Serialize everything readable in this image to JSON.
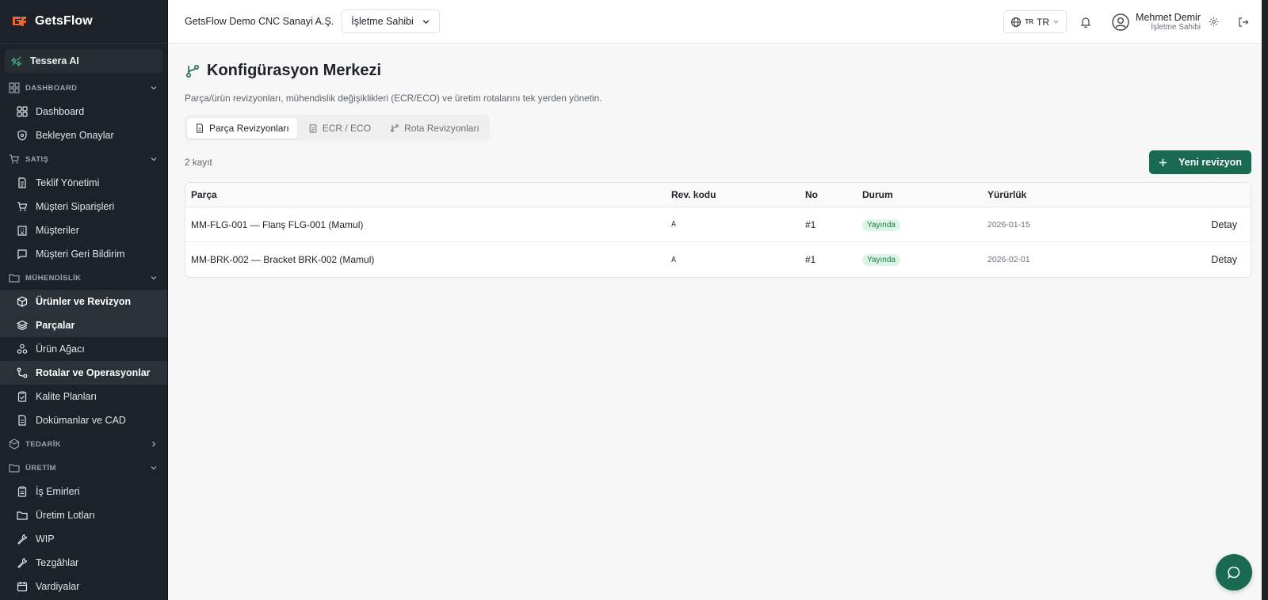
{
  "brand": {
    "name": "GetsFlow",
    "accent": "#f0652f"
  },
  "ai": {
    "label": "Tessera AI"
  },
  "sidebar": {
    "sections": [
      {
        "label": "DASHBOARD",
        "items": [
          {
            "label": "Dashboard",
            "icon": "grid-icon"
          },
          {
            "label": "Bekleyen Onaylar",
            "icon": "shield-icon"
          }
        ]
      },
      {
        "label": "SATIŞ",
        "items": [
          {
            "label": "Teklif Yönetimi",
            "icon": "document-icon"
          },
          {
            "label": "Müşteri Siparişleri",
            "icon": "cart-icon"
          },
          {
            "label": "Müşteriler",
            "icon": "building-icon"
          },
          {
            "label": "Müşteri Geri Bildirim",
            "icon": "message-icon"
          }
        ]
      },
      {
        "label": "MÜHENDİSLİK",
        "items": [
          {
            "label": "Ürünler ve Revizyon",
            "icon": "package-icon"
          },
          {
            "label": "Parçalar",
            "icon": "layers-icon"
          },
          {
            "label": "Ürün Ağacı",
            "icon": "tree-icon"
          },
          {
            "label": "Rotalar ve Operasyonlar",
            "icon": "route-icon"
          },
          {
            "label": "Kalite Planları",
            "icon": "clipboard-check-icon"
          },
          {
            "label": "Dokümanlar ve CAD",
            "icon": "file-icon"
          }
        ]
      },
      {
        "label": "TEDARİK",
        "items": []
      },
      {
        "label": "ÜRETİM",
        "items": [
          {
            "label": "İş Emirleri",
            "icon": "clipboard-icon"
          },
          {
            "label": "Üretim Lotları",
            "icon": "folder-icon"
          },
          {
            "label": "WIP",
            "icon": "wrench-icon"
          },
          {
            "label": "Tezgâhlar",
            "icon": "wrench-icon"
          },
          {
            "label": "Vardiyalar",
            "icon": "calendar-icon"
          }
        ]
      }
    ]
  },
  "header": {
    "company": "GetsFlow Demo CNC Sanayi A.Ş.",
    "role": "İşletme Sahibi",
    "lang_small": "TR",
    "lang": "TR",
    "user_name": "Mehmet Demir",
    "user_role": "İşletme Sahibi"
  },
  "page": {
    "title": "Konfigürasyon Merkezi",
    "subtitle": "Parça/ürün revizyonları, mühendislik değişiklikleri (ECR/ECO) ve üretim rotalarını tek yerden yönetin.",
    "tabs": [
      "Parça Revizyonları",
      "ECR / ECO",
      "Rota Revizyonları"
    ],
    "count": "2 kayıt",
    "new_button": "Yeni revizyon"
  },
  "table": {
    "headers": [
      "Parça",
      "Rev. kodu",
      "No",
      "Durum",
      "Yürürlük"
    ],
    "rows": [
      {
        "part": "MM-FLG-001 — Flanş FLG-001 (Mamul)",
        "rev": "A",
        "no": "#1",
        "status": "Yayında",
        "date": "2026-01-15",
        "action": "Detay"
      },
      {
        "part": "MM-BRK-002 — Bracket BRK-002 (Mamul)",
        "rev": "A",
        "no": "#1",
        "status": "Yayında",
        "date": "2026-02-01",
        "action": "Detay"
      }
    ]
  },
  "colors": {
    "sidebar_bg": "#1c2227",
    "primary": "#1a6a52",
    "badge_bg": "#dcf5e6",
    "badge_text": "#1b7a45"
  }
}
